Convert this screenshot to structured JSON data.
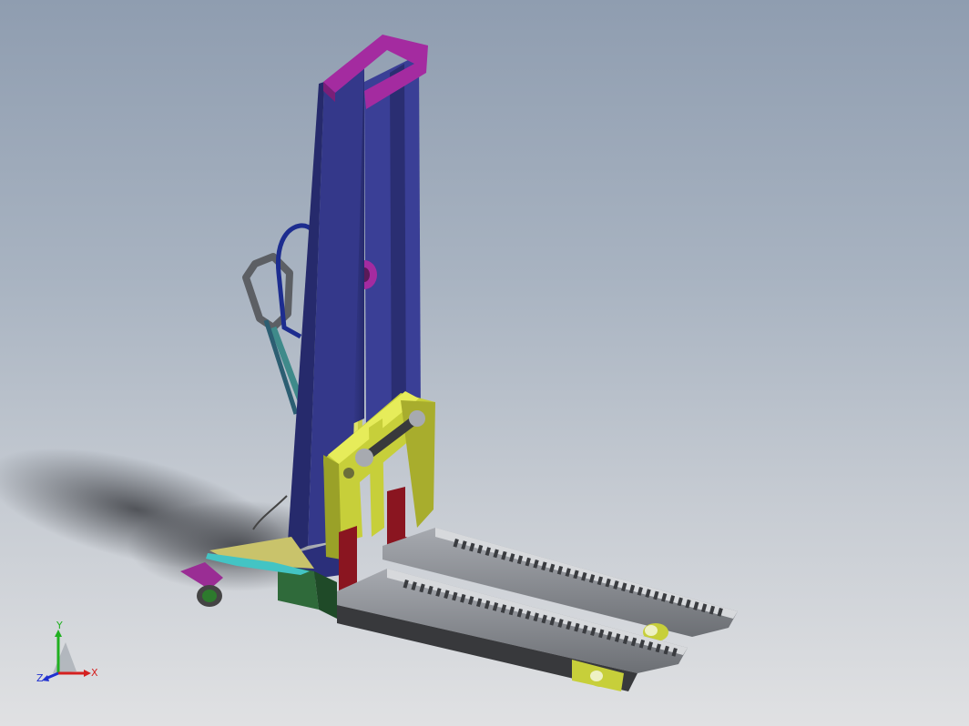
{
  "viewport": {
    "background_top": "#8f9db0",
    "background_bottom": "#e0e1e3"
  },
  "model": {
    "colors": {
      "mast": "#34388a",
      "mast_top_bracket": "#a42ba0",
      "carriage": "#c7cf3a",
      "fork_bracket": "#8a1520",
      "fork": "#8c8f94",
      "chassis_base": "#2f6a3a",
      "handle": "#6b6e73",
      "hydraulic_hose": "#1d2d8f",
      "cylinder": "#c9cc45",
      "steering_wheel_hub": "#2d7a2d",
      "tie_plate": "#43c4c4"
    }
  },
  "triad": {
    "x_label": "X",
    "y_label": "Y",
    "z_label": "Z",
    "x_color": "#d42020",
    "y_color": "#20b020",
    "z_color": "#2030d0"
  }
}
